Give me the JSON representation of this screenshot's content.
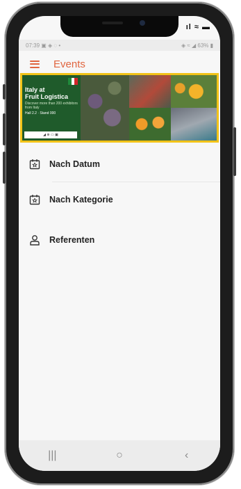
{
  "status_bar": {
    "ios_time": "",
    "ios_indicators": "ıl ≈ ▬",
    "android_left": "07:39 ▣ ◈ ◌ •",
    "android_right": "◈ ≈ ◢ 63% ▮"
  },
  "app_bar": {
    "title": "Events",
    "menu_icon": "hamburger-menu-icon"
  },
  "banner": {
    "title_line1": "Italy at",
    "title_line2": "Fruit Logistica",
    "subtitle": "Discover more than 200 exhibitors from Italy",
    "details": "Hall 2.2 · Stand 000",
    "logos": "◢ ⊕ ▭ ▣",
    "flag_colors": [
      "#1f8a3b",
      "#ffffff",
      "#d3262b"
    ]
  },
  "menu": {
    "items": [
      {
        "label": "Nach Datum",
        "icon": "calendar-star-icon"
      },
      {
        "label": "Nach Kategorie",
        "icon": "calendar-star-icon"
      },
      {
        "label": "Referenten",
        "icon": "person-icon"
      }
    ]
  },
  "nav_bar": {
    "recent": "|||",
    "home": "○",
    "back": "‹"
  },
  "colors": {
    "accent": "#e0653f",
    "highlight": "#f2c318",
    "banner_green": "#1f5b2b"
  }
}
